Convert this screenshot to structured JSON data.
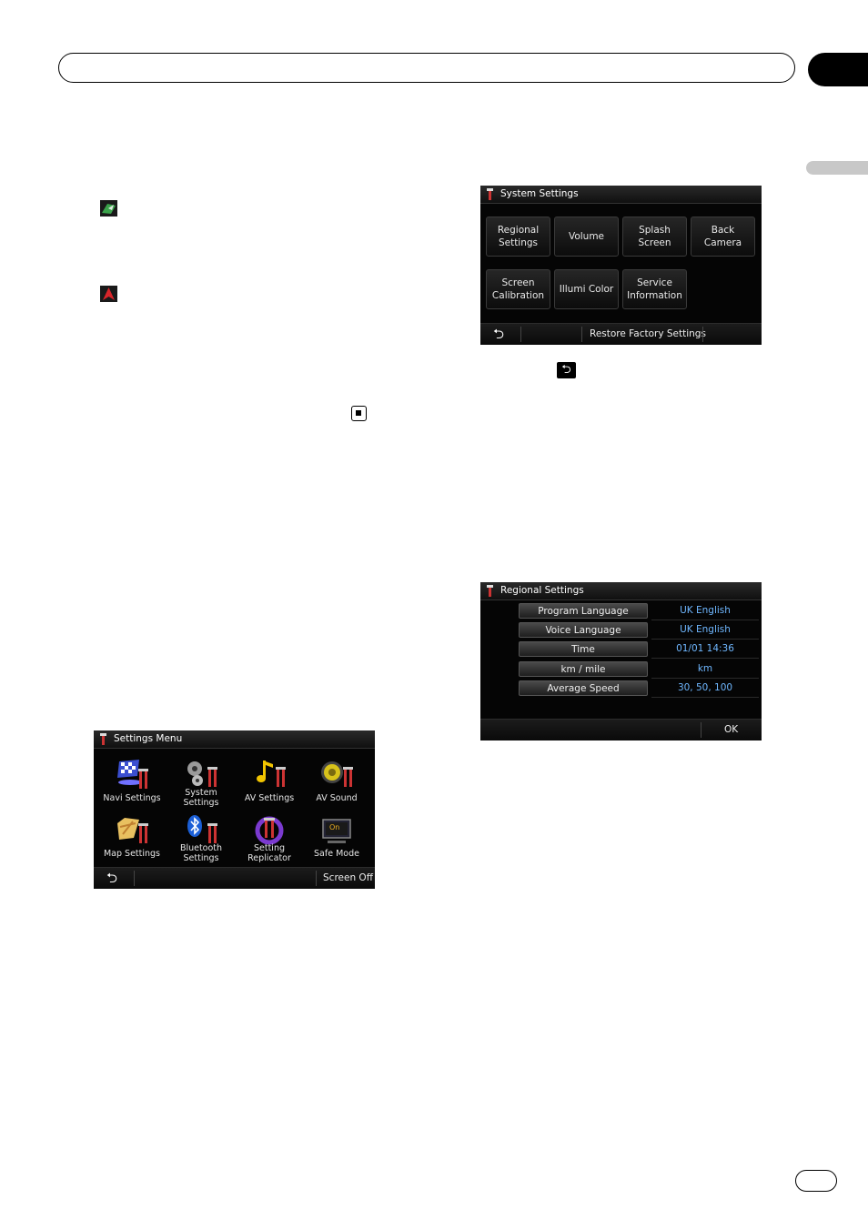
{
  "system_settings": {
    "title": "System Settings",
    "buttons": [
      {
        "label": "Regional\nSettings"
      },
      {
        "label": "Volume"
      },
      {
        "label": "Splash\nScreen"
      },
      {
        "label": "Back\nCamera"
      },
      {
        "label": "Screen\nCalibration"
      },
      {
        "label": "Illumi Color"
      },
      {
        "label": "Service\nInformation"
      }
    ],
    "restore_label": "Restore Factory Settings",
    "back_glyph": "⮌"
  },
  "regional_settings": {
    "title": "Regional Settings",
    "rows": [
      {
        "label": "Program Language",
        "value": "UK English"
      },
      {
        "label": "Voice Language",
        "value": "UK English"
      },
      {
        "label": "Time",
        "value": "01/01 14:36"
      },
      {
        "label": "km / mile",
        "value": "km"
      },
      {
        "label": "Average Speed",
        "value": "30, 50, 100"
      }
    ],
    "ok_label": "OK"
  },
  "settings_menu": {
    "title": "Settings Menu",
    "items": [
      {
        "label": "Navi Settings",
        "icon": "checkered-flag-icon"
      },
      {
        "label": "System\nSettings",
        "icon": "gears-icon"
      },
      {
        "label": "AV Settings",
        "icon": "music-note-icon"
      },
      {
        "label": "AV Sound",
        "icon": "speaker-icon"
      },
      {
        "label": "Map Settings",
        "icon": "map-icon"
      },
      {
        "label": "Bluetooth\nSettings",
        "icon": "bluetooth-icon"
      },
      {
        "label": "Setting\nReplicator",
        "icon": "replicator-icon"
      },
      {
        "label": "Safe Mode",
        "icon": "safe-mode-icon"
      }
    ],
    "safe_mode_badge": "On",
    "screen_off_label": "Screen Off",
    "back_glyph": "⮌"
  },
  "inline_back_glyph": "⮌",
  "colors": {
    "value_text": "#6fb7ff",
    "screen_bg": "#050505"
  }
}
